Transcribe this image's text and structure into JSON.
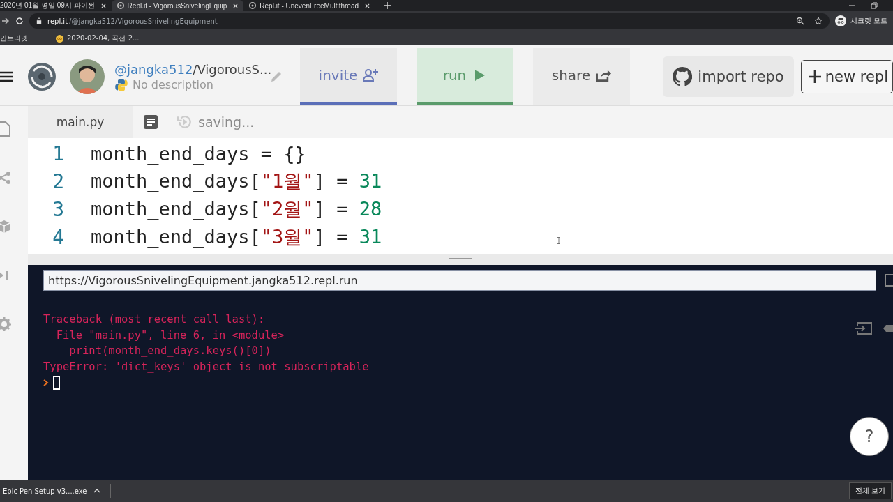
{
  "browser": {
    "tabs": [
      {
        "title": "2020년 01월 평일 09시 파이썬",
        "selected": false,
        "icon": false
      },
      {
        "title": "Repl.it - VigorousSnivelingEquip",
        "selected": true,
        "icon": true
      },
      {
        "title": "Repl.it - UnevenFreeMultithread",
        "selected": false,
        "icon": true
      }
    ],
    "address": {
      "host": "repl.it",
      "path": "/@jangka512/VigorousSnivelingEquipment"
    },
    "profile": "시크릿 모드",
    "bookmarks": [
      {
        "label": "인트라넷",
        "icon": false
      },
      {
        "label": "2020-02-04, 곡선 2...",
        "icon": true
      }
    ]
  },
  "header": {
    "owner": "@jangka512",
    "repl": "/VigorousS...",
    "description": "No description",
    "tabs": [
      {
        "label": "invite",
        "kind": "invite",
        "selected": true
      },
      {
        "label": "run",
        "kind": "run",
        "selected": true
      },
      {
        "label": "share",
        "kind": "share",
        "selected": false
      }
    ],
    "import_label": "import repo",
    "new_label": "new repl"
  },
  "editor": {
    "file": "main.py",
    "status": "saving...",
    "lines": [
      {
        "number": "1",
        "tokens": [
          {
            "t": "month_end_days = {}",
            "kind": "plain"
          }
        ]
      },
      {
        "number": "2",
        "tokens": [
          {
            "t": "month_end_days[",
            "kind": "plain"
          },
          {
            "t": "\"1월\"",
            "kind": "string"
          },
          {
            "t": "] = ",
            "kind": "plain"
          },
          {
            "t": "31",
            "kind": "number"
          }
        ]
      },
      {
        "number": "3",
        "tokens": [
          {
            "t": "month_end_days[",
            "kind": "plain"
          },
          {
            "t": "\"2월\"",
            "kind": "string"
          },
          {
            "t": "] = ",
            "kind": "plain"
          },
          {
            "t": "28",
            "kind": "number"
          }
        ]
      },
      {
        "number": "4",
        "tokens": [
          {
            "t": "month_end_days[",
            "kind": "plain"
          },
          {
            "t": "\"3월\"",
            "kind": "string"
          },
          {
            "t": "] = ",
            "kind": "plain"
          },
          {
            "t": "31",
            "kind": "number"
          }
        ]
      }
    ]
  },
  "console": {
    "url": "https://VigorousSnivelingEquipment.jangka512.repl.run",
    "output": [
      "Traceback (most recent call last):",
      "  File \"main.py\", line 6, in <module>",
      "    print(month_end_days.keys()[0])",
      "TypeError: 'dict_keys' object is not subscriptable"
    ],
    "help": "?"
  },
  "downloads": {
    "file": "Epic Pen Setup v3....exe",
    "show_all": "전체 보기"
  }
}
